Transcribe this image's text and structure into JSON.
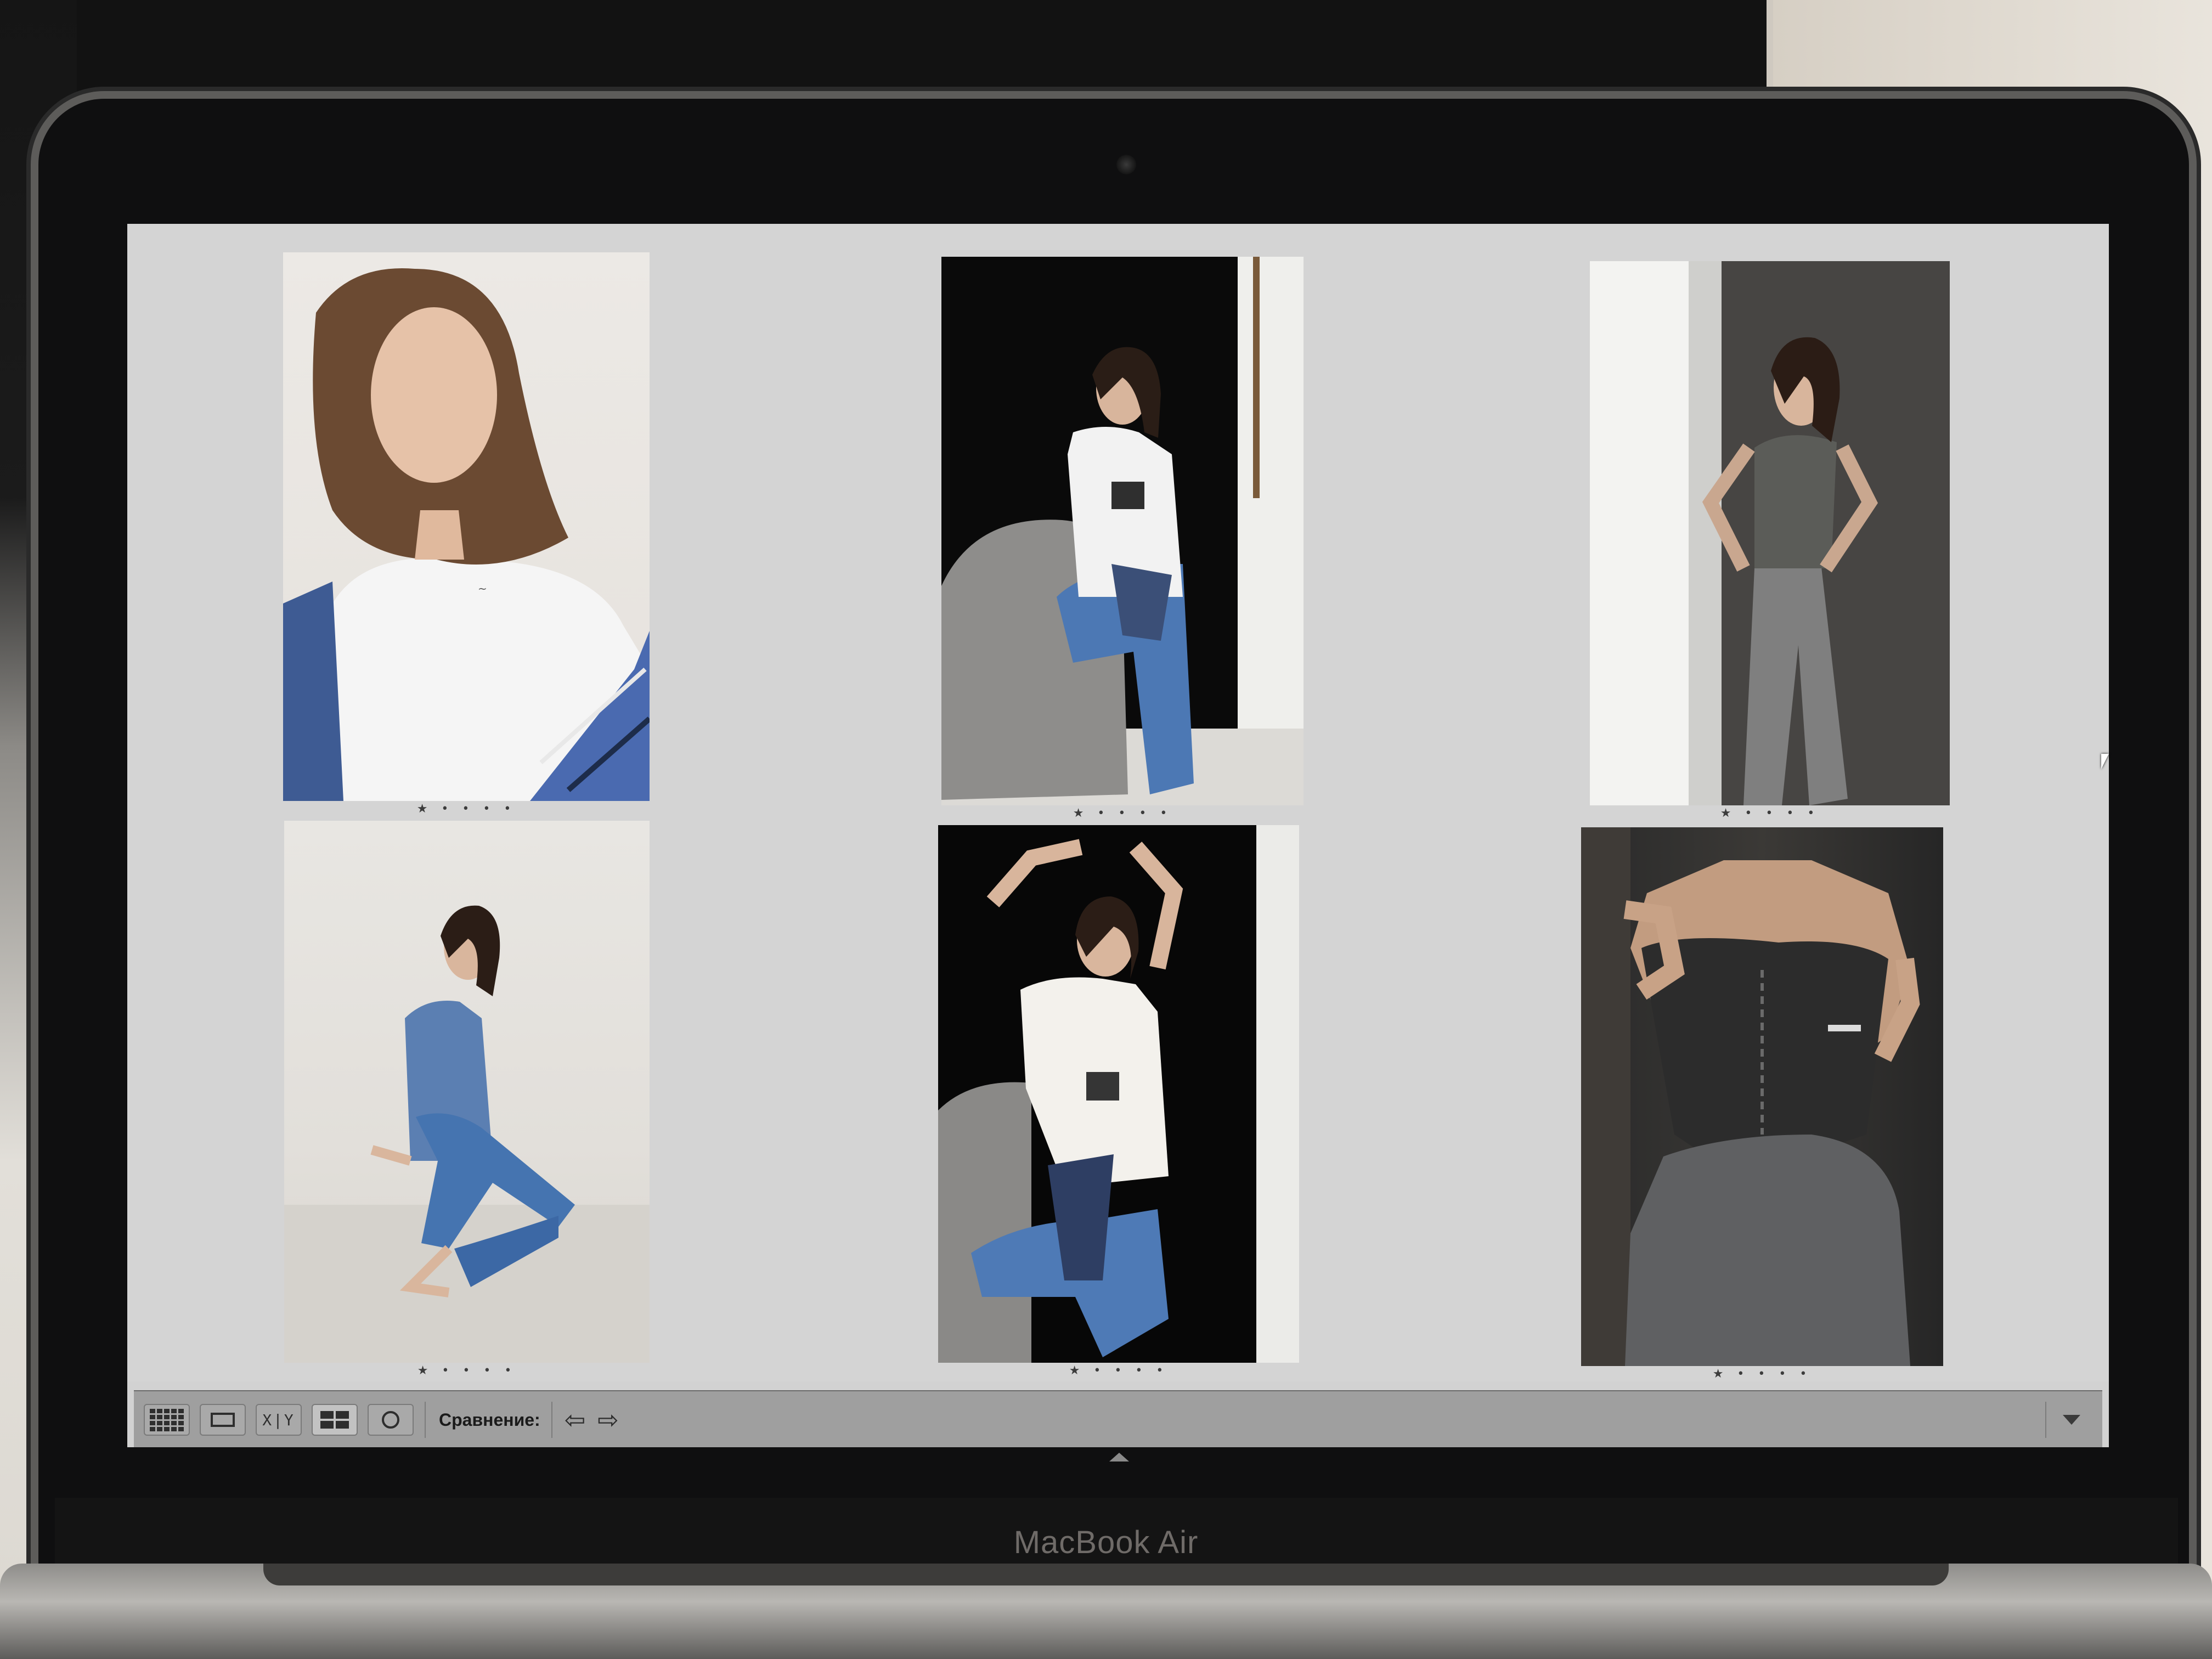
{
  "device": {
    "brand_label": "MacBook Air"
  },
  "survey": {
    "photos": [
      {
        "id": "photo-1",
        "rating": "★ • • • •"
      },
      {
        "id": "photo-2",
        "rating": "★ • • • •"
      },
      {
        "id": "photo-3",
        "rating": "★ • • • •"
      },
      {
        "id": "photo-4",
        "rating": "★ • • • •"
      },
      {
        "id": "photo-5",
        "rating": "★ • • • •"
      },
      {
        "id": "photo-6",
        "rating": "★ • • • •"
      }
    ]
  },
  "toolbar": {
    "view_grid_icon": "grid-view-icon",
    "view_loupe_icon": "loupe-view-icon",
    "view_compare_label": "X|Y",
    "view_survey_icon": "survey-view-icon",
    "view_people_icon": "people-view-icon",
    "compare_label": "Сравнение:",
    "prev_arrow": "⇦",
    "next_arrow": "⇨"
  },
  "colors": {
    "background": "#d4d4d4",
    "toolbar": "#9f9f9f"
  }
}
